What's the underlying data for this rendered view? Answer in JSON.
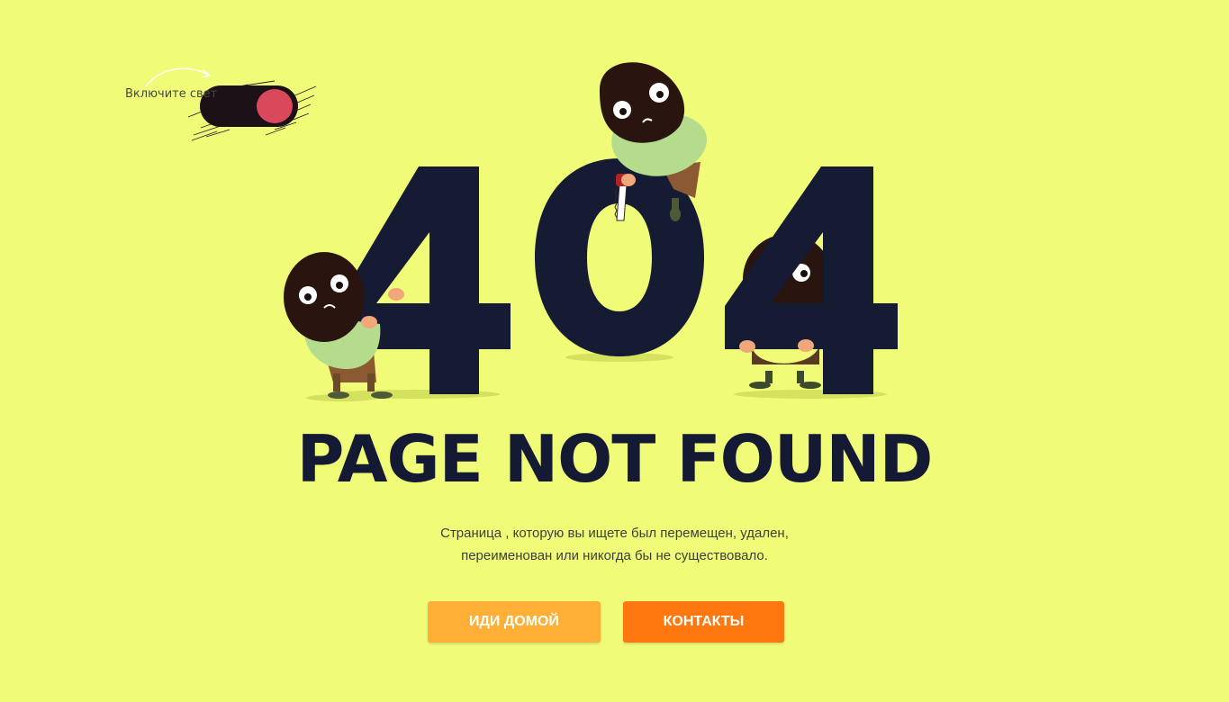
{
  "switch": {
    "label": "Включите свет",
    "state": "off"
  },
  "hero": {
    "code": "404",
    "title": "PAGE NOT FOUND",
    "description_line1": "Страница , которую вы ищете был перемещен, удален,",
    "description_line2": "переименован или никогда бы не существовало."
  },
  "buttons": {
    "home_label": "ИДИ ДОМОЙ",
    "contacts_label": "КОНТАКТЫ"
  },
  "colors": {
    "background": "#f0fc78",
    "digits": "#151b33",
    "home_button": "#feb036",
    "contacts_button": "#fe780f",
    "switch_knob": "#d9495b"
  }
}
